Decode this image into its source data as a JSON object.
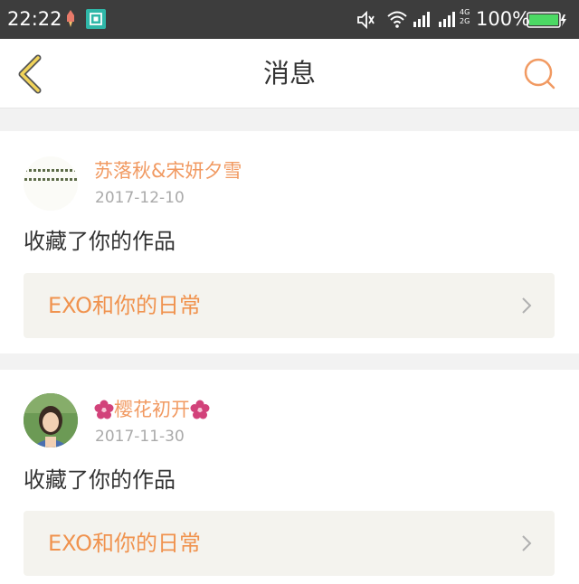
{
  "status_bar": {
    "time": "22:22",
    "network": "4G\n2G",
    "battery": "100%"
  },
  "nav": {
    "title": "消息"
  },
  "messages": [
    {
      "username": "苏落秋&宋妍夕雪",
      "date": "2017-12-10",
      "action": "收藏了你的作品",
      "work_title": "EXO和你的日常"
    },
    {
      "username": "樱花初开",
      "date": "2017-11-30",
      "action": "收藏了你的作品",
      "work_title": "EXO和你的日常"
    }
  ],
  "colors": {
    "accent": "#f19a62",
    "status_bar_bg": "#3d3d3d",
    "battery": "#4cd964"
  }
}
